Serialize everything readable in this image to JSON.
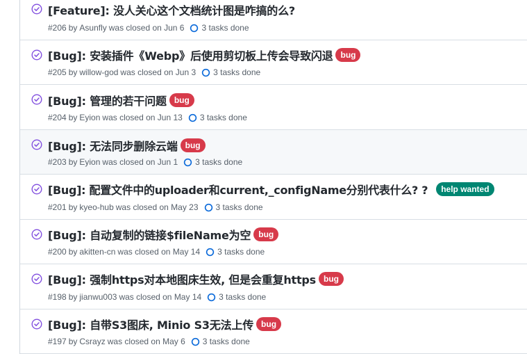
{
  "colors": {
    "closed_icon": "#8250df",
    "bug_label": "#d73a4a",
    "help_wanted_label": "#008672",
    "task_ring": "#0969da"
  },
  "issues": [
    {
      "title": "[Feature]: 没人关心这个文档统计图是咋搞的么?",
      "labels": [],
      "number": "#206",
      "by": "by",
      "author": "Asunfly",
      "closed_text": "was closed on Jun 6",
      "tasks": "3 tasks done"
    },
    {
      "title": "[Bug]: 安装插件《Webp》后使用剪切板上传会导致闪退",
      "labels": [
        "bug"
      ],
      "number": "#205",
      "by": "by",
      "author": "willow-god",
      "closed_text": "was closed on Jun 3",
      "tasks": "3 tasks done"
    },
    {
      "title": "[Bug]: 管理的若干问题",
      "labels": [
        "bug"
      ],
      "number": "#204",
      "by": "by",
      "author": "Eyion",
      "closed_text": "was closed on Jun 13",
      "tasks": "3 tasks done"
    },
    {
      "title": "[Bug]: 无法同步删除云端",
      "labels": [
        "bug"
      ],
      "number": "#203",
      "by": "by",
      "author": "Eyion",
      "closed_text": "was closed on Jun 1",
      "tasks": "3 tasks done"
    },
    {
      "title": "[Bug]: 配置文件中的uploader和current,_configName分别代表什么? ?",
      "labels": [
        "help wanted"
      ],
      "number": "#201",
      "by": "by",
      "author": "kyeo-hub",
      "closed_text": "was closed on May 23",
      "tasks": "3 tasks done"
    },
    {
      "title": "[Bug]: 自动复制的链接$fileName为空",
      "labels": [
        "bug"
      ],
      "number": "#200",
      "by": "by",
      "author": "akitten-cn",
      "closed_text": "was closed on May 14",
      "tasks": "3 tasks done"
    },
    {
      "title": "[Bug]: 强制https对本地图床生效, 但是会重复https",
      "labels": [
        "bug"
      ],
      "number": "#198",
      "by": "by",
      "author": "jianwu003",
      "closed_text": "was closed on May 14",
      "tasks": "3 tasks done"
    },
    {
      "title": "[Bug]: 自带S3图床, Minio S3无法上传",
      "labels": [
        "bug"
      ],
      "number": "#197",
      "by": "by",
      "author": "Csrayz",
      "closed_text": "was closed on May 6",
      "tasks": "3 tasks done"
    }
  ]
}
